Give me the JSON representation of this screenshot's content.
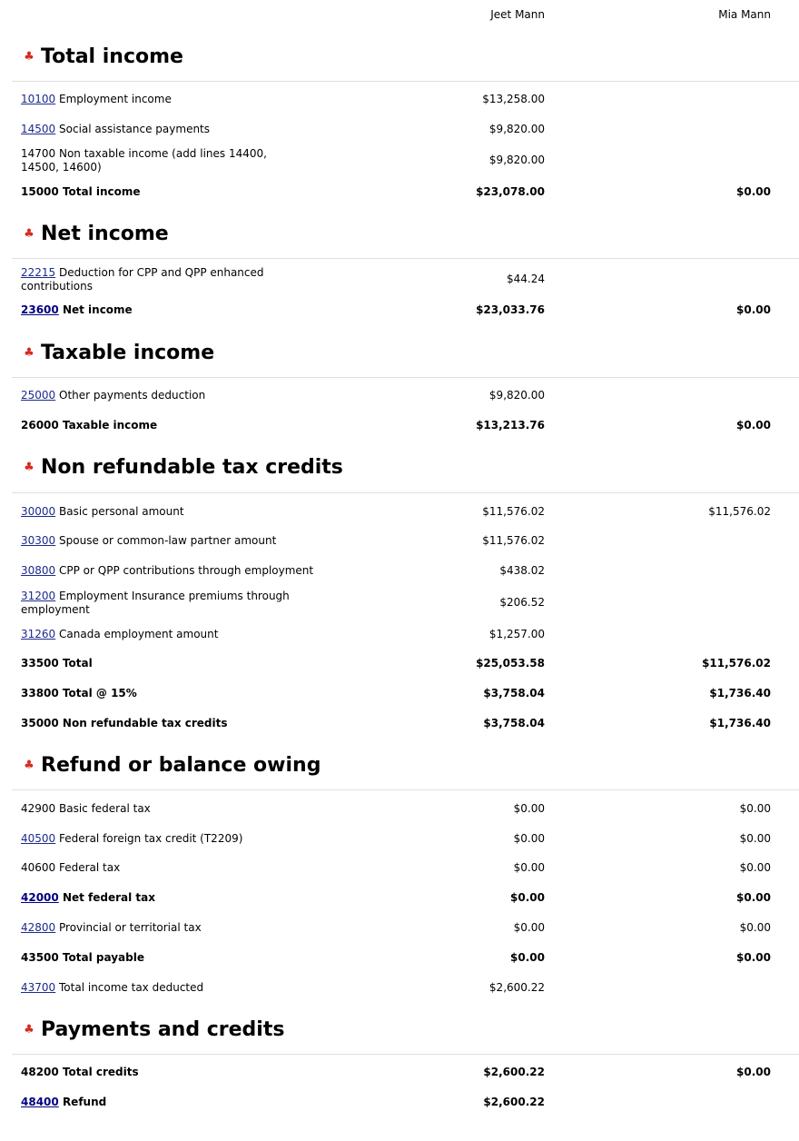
{
  "columns": {
    "person1": "Jeet Mann",
    "person2": "Mia Mann"
  },
  "icon": "maple-leaf-icon",
  "sections": [
    {
      "title": "Total income",
      "rows": [
        {
          "code": "10100",
          "link": true,
          "text": "Employment income",
          "v1": "$13,258.00",
          "v2": ""
        },
        {
          "code": "14500",
          "link": true,
          "text": "Social assistance payments",
          "v1": "$9,820.00",
          "v2": ""
        },
        {
          "code": "",
          "link": false,
          "text": "14700 Non taxable income (add lines 14400, 14500, 14600)",
          "v1": "$9,820.00",
          "v2": ""
        },
        {
          "code": "",
          "link": false,
          "bold": true,
          "text": "15000 Total income",
          "v1": "$23,078.00",
          "v2": "$0.00"
        }
      ]
    },
    {
      "title": "Net income",
      "rows": [
        {
          "code": "22215",
          "link": true,
          "text": "Deduction for CPP and QPP enhanced contributions",
          "v1": "$44.24",
          "v2": ""
        },
        {
          "code": "23600",
          "link": true,
          "bold": true,
          "text": "Net income",
          "v1": "$23,033.76",
          "v2": "$0.00"
        }
      ]
    },
    {
      "title": "Taxable income",
      "rows": [
        {
          "code": "25000",
          "link": true,
          "text": "Other payments deduction",
          "v1": "$9,820.00",
          "v2": ""
        },
        {
          "code": "",
          "link": false,
          "bold": true,
          "text": "26000 Taxable income",
          "v1": "$13,213.76",
          "v2": "$0.00"
        }
      ]
    },
    {
      "title": "Non refundable tax credits",
      "rows": [
        {
          "code": "30000",
          "link": true,
          "text": "Basic personal amount",
          "v1": "$11,576.02",
          "v2": "$11,576.02"
        },
        {
          "code": "30300",
          "link": true,
          "text": "Spouse or common-law partner amount",
          "v1": "$11,576.02",
          "v2": ""
        },
        {
          "code": "30800",
          "link": true,
          "text": "CPP or QPP contributions through employment",
          "v1": "$438.02",
          "v2": ""
        },
        {
          "code": "31200",
          "link": true,
          "text": "Employment Insurance premiums through employment",
          "v1": "$206.52",
          "v2": ""
        },
        {
          "code": "31260",
          "link": true,
          "text": "Canada employment amount",
          "v1": "$1,257.00",
          "v2": ""
        },
        {
          "code": "",
          "link": false,
          "bold": true,
          "text": "33500 Total",
          "v1": "$25,053.58",
          "v2": "$11,576.02"
        },
        {
          "code": "",
          "link": false,
          "bold": true,
          "text": "33800 Total @ 15%",
          "v1": "$3,758.04",
          "v2": "$1,736.40"
        },
        {
          "code": "",
          "link": false,
          "bold": true,
          "text": "35000 Non refundable tax credits",
          "v1": "$3,758.04",
          "v2": "$1,736.40"
        }
      ]
    },
    {
      "title": "Refund or balance owing",
      "rows": [
        {
          "code": "",
          "link": false,
          "text": "42900 Basic federal tax",
          "v1": "$0.00",
          "v2": "$0.00"
        },
        {
          "code": "40500",
          "link": true,
          "text": "Federal foreign tax credit (T2209)",
          "v1": "$0.00",
          "v2": "$0.00"
        },
        {
          "code": "",
          "link": false,
          "text": "40600 Federal tax",
          "v1": "$0.00",
          "v2": "$0.00"
        },
        {
          "code": "42000",
          "link": true,
          "bold": true,
          "text": "Net federal tax",
          "v1": "$0.00",
          "v2": "$0.00"
        },
        {
          "code": "42800",
          "link": true,
          "text": "Provincial or territorial tax",
          "v1": "$0.00",
          "v2": "$0.00"
        },
        {
          "code": "",
          "link": false,
          "bold": true,
          "text": "43500 Total payable",
          "v1": "$0.00",
          "v2": "$0.00"
        },
        {
          "code": "43700",
          "link": true,
          "text": "Total income tax deducted",
          "v1": "$2,600.22",
          "v2": ""
        }
      ]
    },
    {
      "title": "Payments and credits",
      "rows": [
        {
          "code": "",
          "link": false,
          "bold": true,
          "text": "48200 Total credits",
          "v1": "$2,600.22",
          "v2": "$0.00"
        },
        {
          "code": "48400",
          "link": true,
          "bold": true,
          "text": "Refund",
          "v1": "$2,600.22",
          "v2": ""
        }
      ]
    }
  ]
}
